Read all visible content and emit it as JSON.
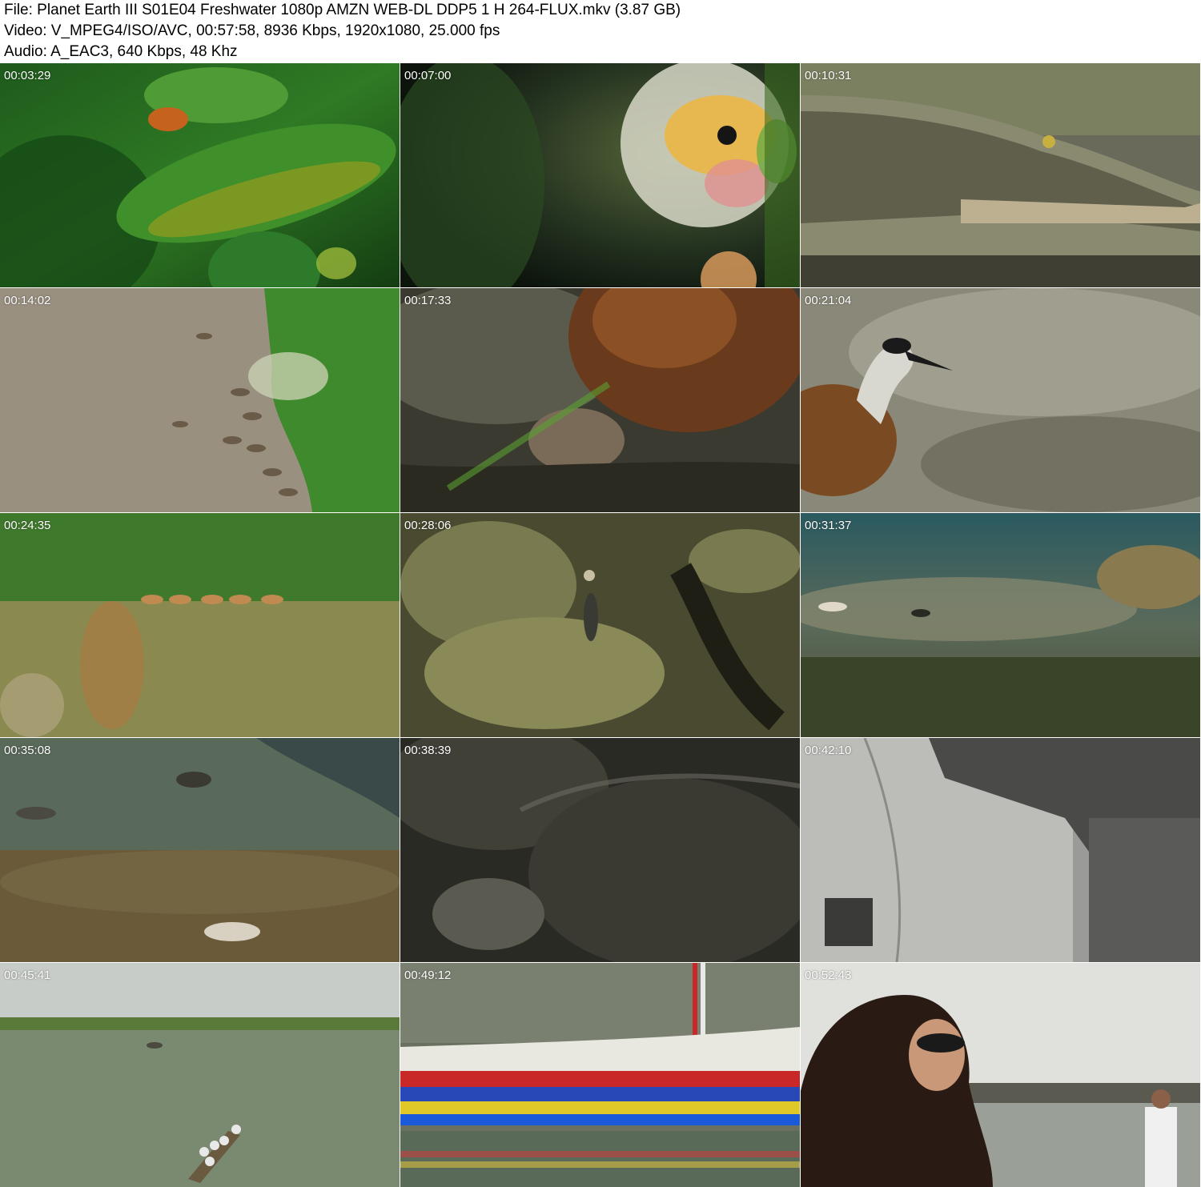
{
  "header": {
    "file_line": "File: Planet Earth III S01E04 Freshwater 1080p AMZN WEB-DL DDP5 1 H 264-FLUX.mkv (3.87 GB)",
    "video_line": "Video: V_MPEG4/ISO/AVC, 00:57:58, 8936 Kbps, 1920x1080, 25.000 fps",
    "audio_line": "Audio: A_EAC3, 640 Kbps, 48 Khz"
  },
  "thumbnails": [
    {
      "timestamp": "00:03:29",
      "subject": "tree-frog-leaves"
    },
    {
      "timestamp": "00:07:00",
      "subject": "tadpole-egg"
    },
    {
      "timestamp": "00:10:31",
      "subject": "crocodile-head"
    },
    {
      "timestamp": "00:14:02",
      "subject": "aerial-herd-grass"
    },
    {
      "timestamp": "00:17:33",
      "subject": "bird-chick-nest"
    },
    {
      "timestamp": "00:21:04",
      "subject": "jacana-bird"
    },
    {
      "timestamp": "00:24:35",
      "subject": "wild-dog-grassland"
    },
    {
      "timestamp": "00:28:06",
      "subject": "wild-dog-aerial-grass"
    },
    {
      "timestamp": "00:31:37",
      "subject": "underwater-riverbed"
    },
    {
      "timestamp": "00:35:08",
      "subject": "underwater-fish-sand"
    },
    {
      "timestamp": "00:38:39",
      "subject": "wet-rock-water"
    },
    {
      "timestamp": "00:42:10",
      "subject": "dam-wall"
    },
    {
      "timestamp": "00:45:41",
      "subject": "boat-people-river"
    },
    {
      "timestamp": "00:49:12",
      "subject": "painted-boat"
    },
    {
      "timestamp": "00:52:43",
      "subject": "woman-riverbank"
    }
  ]
}
